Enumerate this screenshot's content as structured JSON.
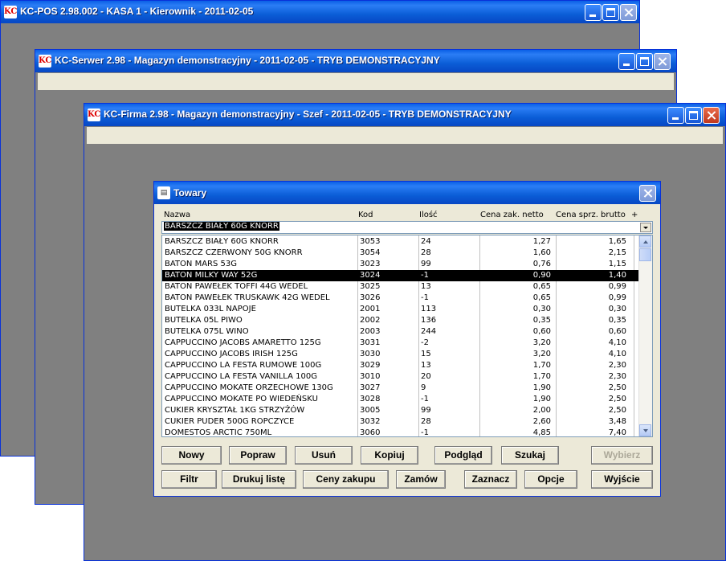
{
  "windows": {
    "pos": {
      "title": "KC-POS 2.98.002 - KASA 1 - Kierownik - 2011-02-05"
    },
    "serwer": {
      "title": "KC-Serwer 2.98 - Magazyn demonstracyjny - 2011-02-05 - TRYB DEMONSTRACYJNY"
    },
    "firma": {
      "title": "KC-Firma 2.98 - Magazyn demonstracyjny - Szef - 2011-02-05 - TRYB DEMONSTRACYJNY"
    },
    "app_icon_glyph": "KC"
  },
  "dialog": {
    "title": "Towary",
    "columns": {
      "name": "Nazwa",
      "kod": "Kod",
      "ilosc": "Ilość",
      "netto": "Cena zak. netto",
      "brutto": "Cena sprz. brutto",
      "plus": "+"
    },
    "combo_value": "BARSZCZ BIAŁY 60G KNORR",
    "rows": [
      {
        "name": "BARSZCZ BIAŁY 60G KNORR",
        "kod": "3053",
        "ilosc": "24",
        "netto": "1,27",
        "brutto": "1,65"
      },
      {
        "name": "BARSZCZ CZERWONY 50G KNORR",
        "kod": "3054",
        "ilosc": "28",
        "netto": "1,60",
        "brutto": "2,15"
      },
      {
        "name": "BATON MARS 53G",
        "kod": "3023",
        "ilosc": "99",
        "netto": "0,76",
        "brutto": "1,15"
      },
      {
        "name": "BATON MILKY WAY 52G",
        "kod": "3024",
        "ilosc": "-1",
        "netto": "0,90",
        "brutto": "1,40",
        "selected": true
      },
      {
        "name": "BATON PAWEŁEK TOFFI 44G WEDEL",
        "kod": "3025",
        "ilosc": "13",
        "netto": "0,65",
        "brutto": "0,99"
      },
      {
        "name": "BATON PAWEŁEK TRUSKAWK 42G WEDEL",
        "kod": "3026",
        "ilosc": "-1",
        "netto": "0,65",
        "brutto": "0,99"
      },
      {
        "name": "BUTELKA 033L NAPOJE",
        "kod": "2001",
        "ilosc": "113",
        "netto": "0,30",
        "brutto": "0,30"
      },
      {
        "name": "BUTELKA 05L PIWO",
        "kod": "2002",
        "ilosc": "136",
        "netto": "0,35",
        "brutto": "0,35"
      },
      {
        "name": "BUTELKA 075L WINO",
        "kod": "2003",
        "ilosc": "244",
        "netto": "0,60",
        "brutto": "0,60"
      },
      {
        "name": "CAPPUCCINO JACOBS AMARETTO 125G",
        "kod": "3031",
        "ilosc": "-2",
        "netto": "3,20",
        "brutto": "4,10"
      },
      {
        "name": "CAPPUCCINO JACOBS IRISH 125G",
        "kod": "3030",
        "ilosc": "15",
        "netto": "3,20",
        "brutto": "4,10"
      },
      {
        "name": "CAPPUCCINO LA FESTA RUMOWE 100G",
        "kod": "3029",
        "ilosc": "13",
        "netto": "1,70",
        "brutto": "2,30"
      },
      {
        "name": "CAPPUCCINO LA FESTA VANILLA 100G",
        "kod": "3010",
        "ilosc": "20",
        "netto": "1,70",
        "brutto": "2,30"
      },
      {
        "name": "CAPPUCCINO MOKATE ORZECHOWE 130G",
        "kod": "3027",
        "ilosc": "9",
        "netto": "1,90",
        "brutto": "2,50"
      },
      {
        "name": "CAPPUCCINO MOKATE PO WIEDEŃSKU",
        "kod": "3028",
        "ilosc": "-1",
        "netto": "1,90",
        "brutto": "2,50"
      },
      {
        "name": "CUKIER KRYSZTAŁ 1KG STRZYŻÓW",
        "kod": "3005",
        "ilosc": "99",
        "netto": "2,00",
        "brutto": "2,50"
      },
      {
        "name": "CUKIER PUDER 500G ROPCZYCE",
        "kod": "3032",
        "ilosc": "28",
        "netto": "2,60",
        "brutto": "3,48"
      },
      {
        "name": "DOMESTOS ARCTIC 750ML",
        "kod": "3060",
        "ilosc": "-1",
        "netto": "4,85",
        "brutto": "7,40"
      }
    ],
    "buttons_row1": [
      {
        "id": "nowy",
        "label": "Nowy"
      },
      {
        "id": "popraw",
        "label": "Popraw"
      },
      {
        "id": "usun",
        "label": "Usuń"
      },
      {
        "id": "kopiuj",
        "label": "Kopiuj"
      },
      {
        "id": "podglad",
        "label": "Podgląd"
      },
      {
        "id": "szukaj",
        "label": "Szukaj"
      },
      {
        "id": "wybierz",
        "label": "Wybierz",
        "disabled": true
      }
    ],
    "buttons_row2": [
      {
        "id": "filtr",
        "label": "Filtr"
      },
      {
        "id": "drukuj-liste",
        "label": "Drukuj listę"
      },
      {
        "id": "ceny-zakupu",
        "label": "Ceny zakupu"
      },
      {
        "id": "zamow",
        "label": "Zamów"
      },
      {
        "id": "zaznacz",
        "label": "Zaznacz"
      },
      {
        "id": "opcje",
        "label": "Opcje"
      },
      {
        "id": "wyjscie",
        "label": "Wyjście"
      }
    ]
  }
}
